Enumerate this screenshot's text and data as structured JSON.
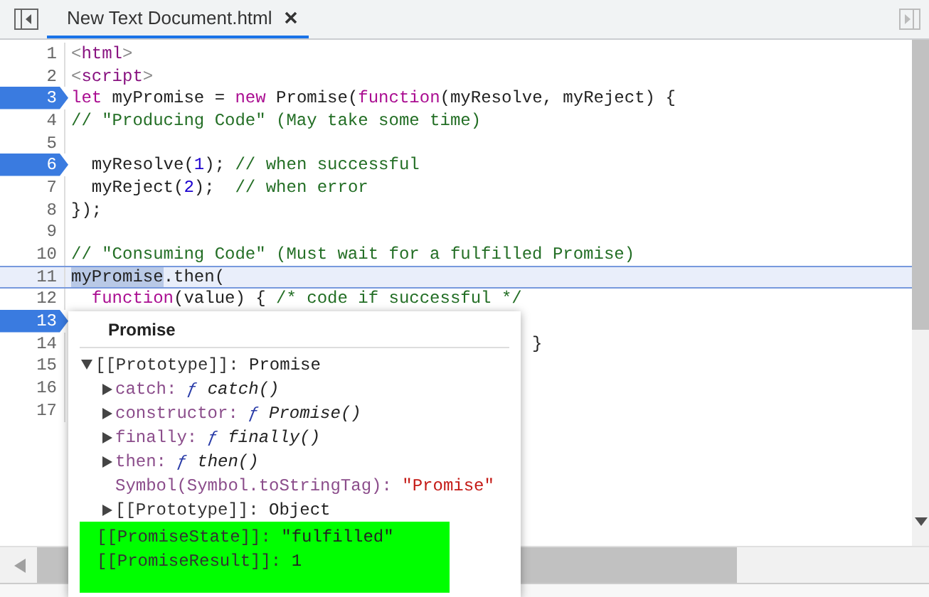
{
  "tabs": [
    {
      "label": "New Text Document.html",
      "selected": true
    }
  ],
  "editor": {
    "lines": [
      {
        "number": "1",
        "breakpoint": false,
        "current": false,
        "tokens": [
          {
            "text": "<",
            "kind": "punct"
          },
          {
            "text": "html",
            "kind": "tag"
          },
          {
            "text": ">",
            "kind": "punct"
          }
        ]
      },
      {
        "number": "2",
        "breakpoint": false,
        "current": false,
        "tokens": [
          {
            "text": "<",
            "kind": "punct"
          },
          {
            "text": "script",
            "kind": "tag"
          },
          {
            "text": ">",
            "kind": "punct"
          }
        ]
      },
      {
        "number": "3",
        "breakpoint": true,
        "current": false,
        "tokens": [
          {
            "text": "let",
            "kind": "keyword"
          },
          {
            "text": " myPromise = ",
            "kind": "plain"
          },
          {
            "text": "new",
            "kind": "keyword"
          },
          {
            "text": " Promise(",
            "kind": "plain"
          },
          {
            "text": "function",
            "kind": "keyword"
          },
          {
            "text": "(myResolve, myReject) {",
            "kind": "plain"
          }
        ]
      },
      {
        "number": "4",
        "breakpoint": false,
        "current": false,
        "tokens": [
          {
            "text": "// \"Producing Code\" (May take some time)",
            "kind": "comment"
          }
        ]
      },
      {
        "number": "5",
        "breakpoint": false,
        "current": false
      },
      {
        "number": "6",
        "breakpoint": true,
        "current": false,
        "tokens": [
          {
            "text": "  myResolve(",
            "kind": "plain"
          },
          {
            "text": "1",
            "kind": "number"
          },
          {
            "text": "); ",
            "kind": "plain"
          },
          {
            "text": "// when successful",
            "kind": "comment"
          }
        ]
      },
      {
        "number": "7",
        "breakpoint": false,
        "current": false,
        "tokens": [
          {
            "text": "  myReject(",
            "kind": "plain"
          },
          {
            "text": "2",
            "kind": "number"
          },
          {
            "text": ");  ",
            "kind": "plain"
          },
          {
            "text": "// when error",
            "kind": "comment"
          }
        ]
      },
      {
        "number": "8",
        "breakpoint": false,
        "current": false,
        "tokens": [
          {
            "text": "});",
            "kind": "plain"
          }
        ]
      },
      {
        "number": "9",
        "breakpoint": false,
        "current": false
      },
      {
        "number": "10",
        "breakpoint": false,
        "current": false,
        "tokens": [
          {
            "text": "// \"Consuming Code\" (Must wait for a fulfilled Promise)",
            "kind": "comment"
          }
        ]
      },
      {
        "number": "11",
        "breakpoint": false,
        "current": true,
        "tokens": [
          {
            "text": "myPromise",
            "kind": "selection"
          },
          {
            "text": ".then(",
            "kind": "plain"
          }
        ]
      },
      {
        "number": "12",
        "breakpoint": false,
        "current": false,
        "tokens": [
          {
            "text": "  function",
            "kind": "keyword"
          },
          {
            "text": "(value) { ",
            "kind": "plain"
          },
          {
            "text": "/* code if successful */",
            "kind": "comment"
          }
        ]
      },
      {
        "number": "13",
        "breakpoint": true,
        "current": false
      },
      {
        "number": "14",
        "breakpoint": false,
        "current": false,
        "tokens": [
          {
            "text": "                                             }",
            "kind": "plain"
          }
        ]
      },
      {
        "number": "15",
        "breakpoint": false,
        "current": false
      },
      {
        "number": "16",
        "breakpoint": false,
        "current": false
      },
      {
        "number": "17",
        "breakpoint": false,
        "current": false
      }
    ]
  },
  "popover": {
    "title": "Promise",
    "properties": [
      {
        "key": "[[Prototype]]:",
        "kind": "internal",
        "value": "Promise",
        "expanded": true,
        "children": [
          {
            "key": "catch:",
            "kind": "method",
            "marker": "ƒ",
            "value": "catch()",
            "expanded": false
          },
          {
            "key": "constructor:",
            "kind": "method",
            "marker": "ƒ",
            "value": "Promise()",
            "expanded": false
          },
          {
            "key": "finally:",
            "kind": "method",
            "marker": "ƒ",
            "value": "finally()",
            "expanded": false
          },
          {
            "key": "then:",
            "kind": "method",
            "marker": "ƒ",
            "value": "then()",
            "expanded": false
          },
          {
            "key": "Symbol(Symbol.toStringTag):",
            "kind": "string",
            "value": "\"Promise\""
          },
          {
            "key": "[[Prototype]]:",
            "kind": "internal",
            "value": "Object",
            "expanded": false
          }
        ]
      }
    ],
    "internal_slots": {
      "highlighted": true,
      "items": [
        {
          "key": "[[PromiseState]]:",
          "kind": "internal",
          "value": "\"fulfilled\""
        },
        {
          "key": "[[PromiseResult]]:",
          "kind": "internal",
          "value": "1"
        }
      ]
    }
  }
}
